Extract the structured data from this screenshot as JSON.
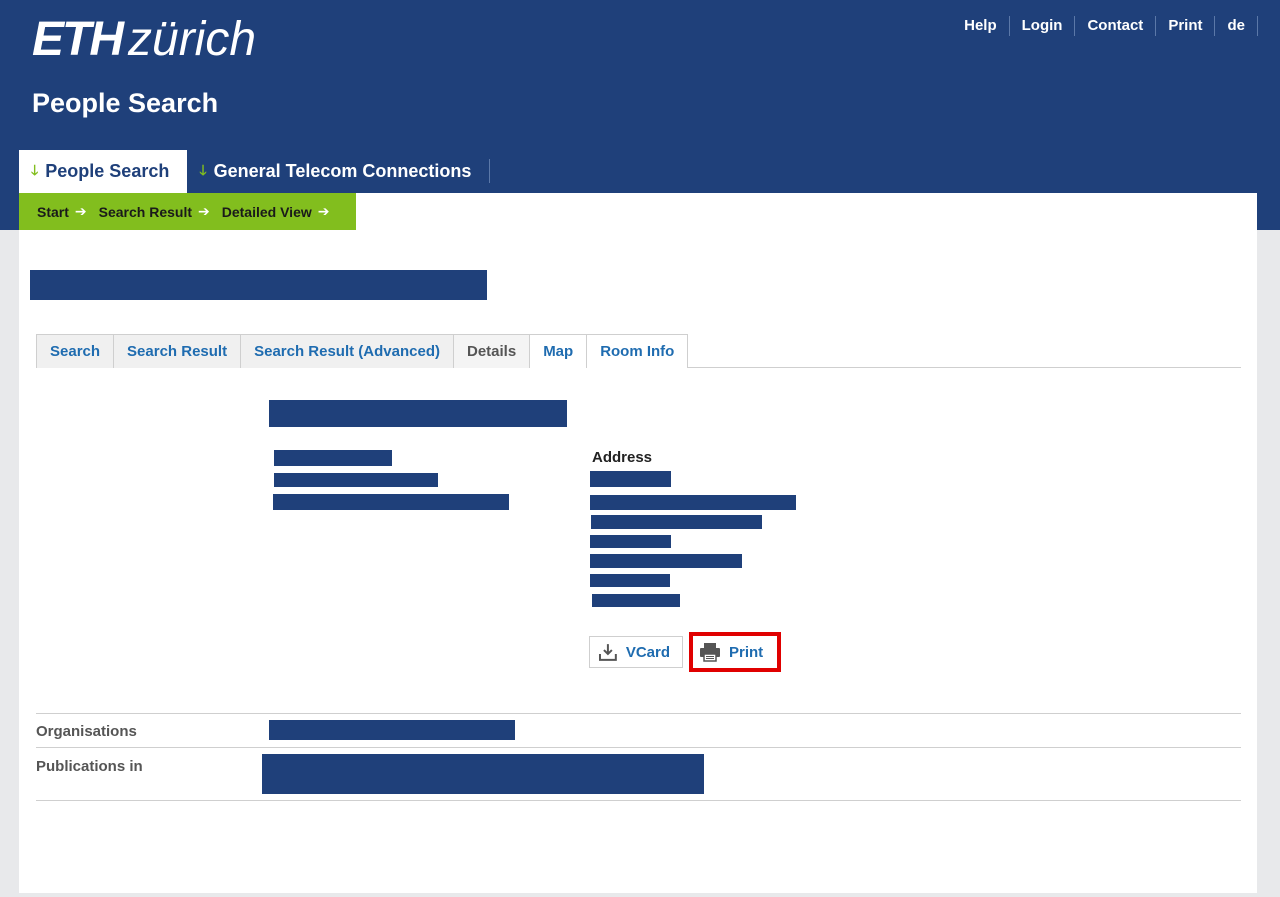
{
  "header": {
    "logo_eth": "ETH",
    "logo_zurich": "zürich",
    "app_title": "People Search",
    "meta_nav": [
      "Help",
      "Login",
      "Contact",
      "Print",
      "de"
    ]
  },
  "main_nav": {
    "items": [
      {
        "label": "People Search",
        "active": true
      },
      {
        "label": "General Telecom Connections",
        "active": false
      }
    ]
  },
  "breadcrumb": [
    "Start",
    "Search Result",
    "Detailed View"
  ],
  "tabs": [
    "Search",
    "Search Result",
    "Search Result (Advanced)",
    "Details",
    "Map",
    "Room Info"
  ],
  "details": {
    "address_label": "Address",
    "vcard_label": "VCard",
    "print_label": "Print"
  },
  "rows": {
    "organisations_label": "Organisations",
    "publications_label": "Publications in"
  },
  "colors": {
    "eth_blue": "#1f407a",
    "eth_green": "#82be1e",
    "link_blue": "#1f6cb0",
    "highlight_red": "#e00000"
  }
}
